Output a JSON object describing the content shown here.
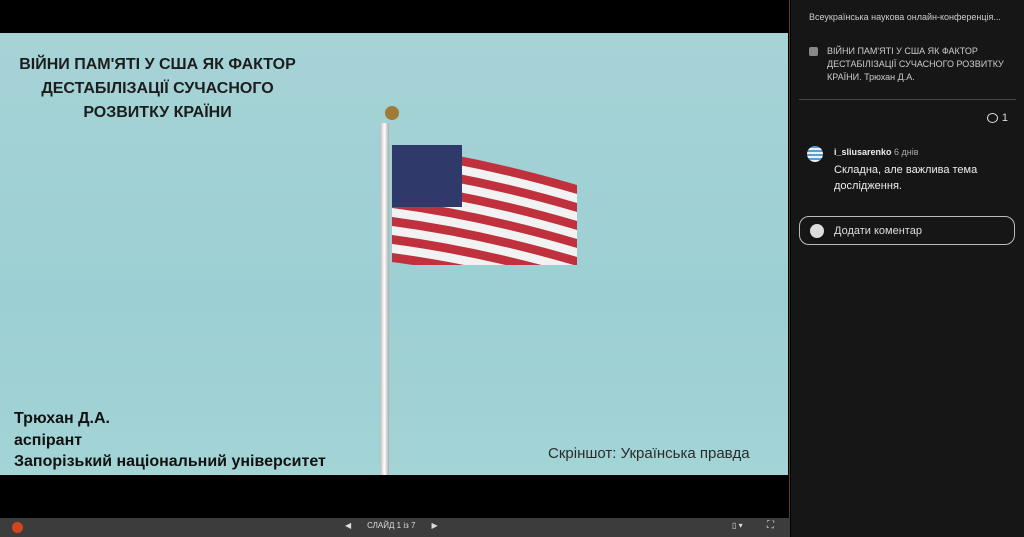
{
  "slide": {
    "title": "ВІЙНИ ПАМ'ЯТІ У США ЯК ФАКТОР ДЕСТАБІЛІЗАЦІЇ СУЧАСНОГО РОЗВИТКУ КРАЇНИ",
    "author_lines": [
      "Трюхан Д.А.",
      "аспірант",
      "Запорізький національний університет"
    ],
    "credit": "Скріншот: Українська правда"
  },
  "controls": {
    "slide_counter": "СЛАЙД 1 із 7",
    "prev": "◀",
    "next": "▶",
    "view": "▯ ▾",
    "fullscreen": "⛶"
  },
  "sidebar": {
    "conference": "Всеукраїнська наукова онлайн-конференція...",
    "video_title": "ВІЙНИ ПАМ'ЯТІ У США ЯК ФАКТОР ДЕСТАБІЛІЗАЦІЇ СУЧАСНОГО РОЗВИТКУ КРАЇНИ. Трюхан Д.А.",
    "comment_count": "1",
    "comments": [
      {
        "user": "i_sliusarenko",
        "time": "6 днів",
        "text": "Складна, але важлива тема дослідження."
      }
    ],
    "add_comment": "Додати коментар"
  }
}
